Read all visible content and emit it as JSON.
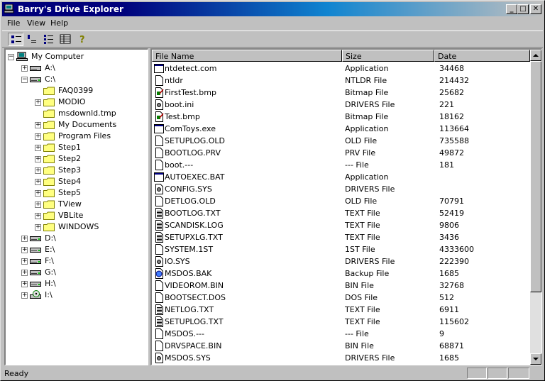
{
  "window": {
    "title": "Barry's Drive Explorer"
  },
  "menu": [
    "File",
    "View",
    "Help"
  ],
  "toolbar": [
    {
      "icon": "large-icons-view-icon",
      "pressed": true
    },
    {
      "icon": "small-icons-view-icon",
      "pressed": false
    },
    {
      "icon": "list-view-icon",
      "pressed": false
    },
    {
      "icon": "details-view-icon",
      "pressed": false
    },
    {
      "icon": "help-icon",
      "pressed": false
    }
  ],
  "tree": {
    "root": "My Computer",
    "nodes": [
      {
        "label": "A:\\",
        "level": 1,
        "type": "floppy",
        "expander": "+"
      },
      {
        "label": "C:\\",
        "level": 1,
        "type": "drive",
        "expander": "-"
      },
      {
        "label": "FAQ0399",
        "level": 2,
        "type": "folder",
        "expander": ""
      },
      {
        "label": "MODIO",
        "level": 2,
        "type": "folder",
        "expander": "+"
      },
      {
        "label": "msdownld.tmp",
        "level": 2,
        "type": "folder",
        "expander": ""
      },
      {
        "label": "My Documents",
        "level": 2,
        "type": "folder",
        "expander": "+"
      },
      {
        "label": "Program Files",
        "level": 2,
        "type": "folder",
        "expander": "+"
      },
      {
        "label": "Step1",
        "level": 2,
        "type": "folder",
        "expander": "+"
      },
      {
        "label": "Step2",
        "level": 2,
        "type": "folder",
        "expander": "+"
      },
      {
        "label": "Step3",
        "level": 2,
        "type": "folder",
        "expander": "+"
      },
      {
        "label": "Step4",
        "level": 2,
        "type": "folder",
        "expander": "+"
      },
      {
        "label": "Step5",
        "level": 2,
        "type": "folder",
        "expander": "+"
      },
      {
        "label": "TView",
        "level": 2,
        "type": "folder",
        "expander": "+"
      },
      {
        "label": "VBLite",
        "level": 2,
        "type": "folder",
        "expander": "+"
      },
      {
        "label": "WINDOWS",
        "level": 2,
        "type": "folder",
        "expander": "+"
      },
      {
        "label": "D:\\",
        "level": 1,
        "type": "drive",
        "expander": "+"
      },
      {
        "label": "E:\\",
        "level": 1,
        "type": "drive",
        "expander": "+"
      },
      {
        "label": "F:\\",
        "level": 1,
        "type": "drive",
        "expander": "+"
      },
      {
        "label": "G:\\",
        "level": 1,
        "type": "drive",
        "expander": "+"
      },
      {
        "label": "H:\\",
        "level": 1,
        "type": "drive",
        "expander": "+"
      },
      {
        "label": "I:\\",
        "level": 1,
        "type": "cdrom",
        "expander": "+"
      }
    ]
  },
  "columns": [
    "File Name",
    "Size",
    "Date"
  ],
  "files": [
    {
      "name": "ntdetect.com",
      "type": "Application",
      "date": "34468",
      "icon": "app"
    },
    {
      "name": "ntldr",
      "type": "NTLDR File",
      "date": "214432",
      "icon": "file"
    },
    {
      "name": "FirstTest.bmp",
      "type": "Bitmap File",
      "date": "25682",
      "icon": "bmp"
    },
    {
      "name": "boot.ini",
      "type": "DRIVERS File",
      "date": "221",
      "icon": "sys"
    },
    {
      "name": "Test.bmp",
      "type": "Bitmap File",
      "date": "18162",
      "icon": "bmp"
    },
    {
      "name": "ComToys.exe",
      "type": "Application",
      "date": "113664",
      "icon": "app"
    },
    {
      "name": "SETUPLOG.OLD",
      "type": "OLD File",
      "date": "735588",
      "icon": "file"
    },
    {
      "name": "BOOTLOG.PRV",
      "type": "PRV File",
      "date": "49872",
      "icon": "file"
    },
    {
      "name": "boot.---",
      "type": "--- File",
      "date": "181",
      "icon": "file"
    },
    {
      "name": "AUTOEXEC.BAT",
      "type": "Application",
      "date": "",
      "icon": "app"
    },
    {
      "name": "CONFIG.SYS",
      "type": "DRIVERS File",
      "date": "",
      "icon": "sys"
    },
    {
      "name": "DETLOG.OLD",
      "type": "OLD File",
      "date": "70791",
      "icon": "file"
    },
    {
      "name": "BOOTLOG.TXT",
      "type": "TEXT File",
      "date": "52419",
      "icon": "txt"
    },
    {
      "name": "SCANDISK.LOG",
      "type": "TEXT File",
      "date": "9806",
      "icon": "txt"
    },
    {
      "name": "SETUPXLG.TXT",
      "type": "TEXT File",
      "date": "3436",
      "icon": "txt"
    },
    {
      "name": "SYSTEM.1ST",
      "type": "1ST File",
      "date": "4333600",
      "icon": "file"
    },
    {
      "name": "IO.SYS",
      "type": "DRIVERS File",
      "date": "222390",
      "icon": "sys"
    },
    {
      "name": "MSDOS.BAK",
      "type": "Backup File",
      "date": "1685",
      "icon": "bak"
    },
    {
      "name": "VIDEOROM.BIN",
      "type": "BIN File",
      "date": "32768",
      "icon": "file"
    },
    {
      "name": "BOOTSECT.DOS",
      "type": "DOS File",
      "date": "512",
      "icon": "file"
    },
    {
      "name": "NETLOG.TXT",
      "type": "TEXT File",
      "date": "6911",
      "icon": "txt"
    },
    {
      "name": "SETUPLOG.TXT",
      "type": "TEXT File",
      "date": "115602",
      "icon": "txt"
    },
    {
      "name": "MSDOS.---",
      "type": "--- File",
      "date": "9",
      "icon": "file"
    },
    {
      "name": "DRVSPACE.BIN",
      "type": "BIN File",
      "date": "68871",
      "icon": "file"
    },
    {
      "name": "MSDOS.SYS",
      "type": "DRIVERS File",
      "date": "1685",
      "icon": "sys"
    }
  ],
  "status": "Ready"
}
